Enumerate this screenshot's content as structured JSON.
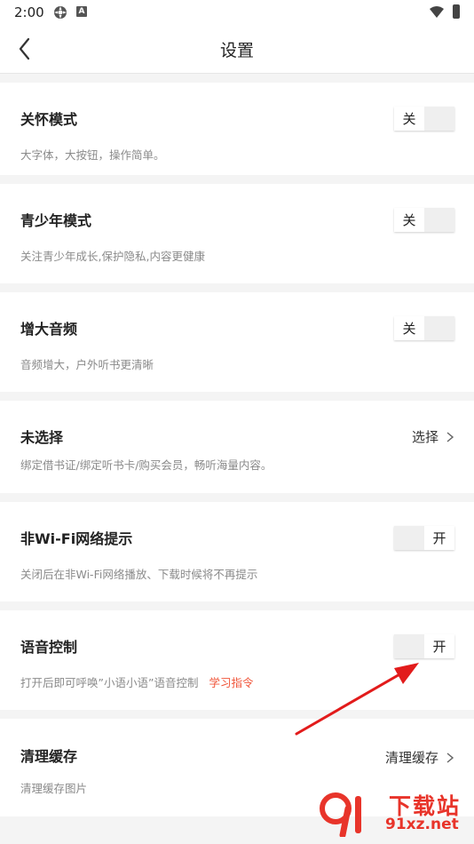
{
  "status_bar": {
    "time": "2:00",
    "icon2_letter": "A"
  },
  "header": {
    "title": "设置"
  },
  "settings": [
    {
      "title": "关怀模式",
      "desc": "大字体，大按钮，操作简单。",
      "toggle": "关"
    },
    {
      "title": "青少年模式",
      "desc": "关注青少年成长,保护隐私,内容更健康",
      "toggle": "关"
    },
    {
      "title": "增大音频",
      "desc": "音频增大，户外听书更清晰",
      "toggle": "关"
    },
    {
      "title": "未选择",
      "desc": "绑定借书证/绑定听书卡/购买会员，畅听海量内容。",
      "action": "选择"
    },
    {
      "title": "非Wi-Fi网络提示",
      "desc": "关闭后在非Wi-Fi网络播放、下载时候将不再提示",
      "toggle": "开"
    },
    {
      "title": "语音控制",
      "desc": "打开后即可呼唤”小语小语”语音控制",
      "link": "学习指令",
      "toggle": "开"
    },
    {
      "title": "清理缓存",
      "desc": "清理缓存图片",
      "action": "清理缓存"
    }
  ],
  "watermark": {
    "title": "下载站",
    "url": "91xz.net"
  },
  "colors": {
    "accent": "#f0553a",
    "background": "#f4f4f4",
    "watermark": "#e8342a",
    "annotation_arrow": "#e21b1b"
  }
}
